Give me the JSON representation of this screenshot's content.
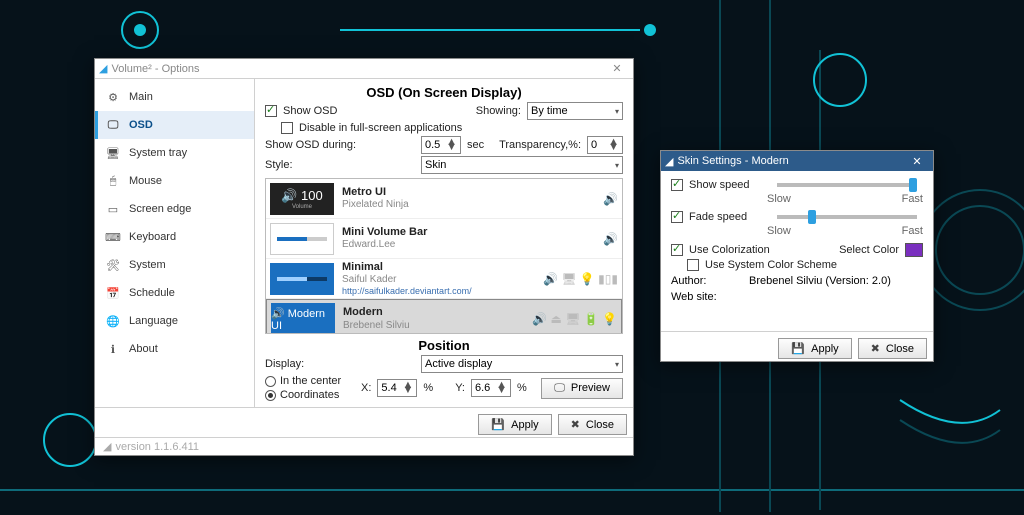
{
  "main": {
    "title": "Volume² - Options",
    "sidebar": [
      {
        "label": "Main"
      },
      {
        "label": "OSD"
      },
      {
        "label": "System tray"
      },
      {
        "label": "Mouse"
      },
      {
        "label": "Screen edge"
      },
      {
        "label": "Keyboard"
      },
      {
        "label": "System"
      },
      {
        "label": "Schedule"
      },
      {
        "label": "Language"
      },
      {
        "label": "About"
      }
    ],
    "osd": {
      "heading": "OSD (On Screen Display)",
      "show_osd": "Show OSD",
      "disable_fs": "Disable in full-screen applications",
      "show_during": "Show OSD during:",
      "show_during_val": "0.5",
      "sec": "sec",
      "showing": "Showing:",
      "showing_val": "By time",
      "transparency": "Transparency,%:",
      "transparency_val": "0",
      "style": "Style:",
      "style_val": "Skin",
      "skins": [
        {
          "name": "Metro UI",
          "author": "Pixelated Ninja",
          "preview_text": "🔊  100",
          "preview_sub": "Volume",
          "preview_bg": "#222"
        },
        {
          "name": "Mini Volume Bar",
          "author": "Edward.Lee",
          "preview_text": "",
          "preview_bg": "#fff"
        },
        {
          "name": "Minimal",
          "author": "Saiful Kader",
          "link": "http://saifulkader.deviantart.com/",
          "preview_text": "▮▮▮▮",
          "preview_bg": "#1a6fc0"
        },
        {
          "name": "Modern",
          "author": "Brebenel Silviu",
          "preview_text": "🔊 Modern UI",
          "preview_bg": "#1a6fc0"
        }
      ],
      "position": {
        "heading": "Position",
        "display": "Display:",
        "display_val": "Active display",
        "center": "In the center",
        "coords": "Coordinates",
        "x": "X:",
        "x_val": "5.4",
        "y": "Y:",
        "y_val": "6.6",
        "pct": "%",
        "preview": "Preview"
      }
    },
    "apply": "Apply",
    "close": "Close",
    "version": "version 1.1.6.411"
  },
  "skin": {
    "title": "Skin Settings - Modern",
    "show_speed": "Show speed",
    "fade_speed": "Fade speed",
    "slow": "Slow",
    "fast": "Fast",
    "use_color": "Use Colorization",
    "select_color": "Select Color",
    "use_system": "Use System Color Scheme",
    "author_lbl": "Author:",
    "author_val": "Brebenel Silviu (Version: 2.0)",
    "website_lbl": "Web site:",
    "apply": "Apply",
    "close": "Close"
  }
}
